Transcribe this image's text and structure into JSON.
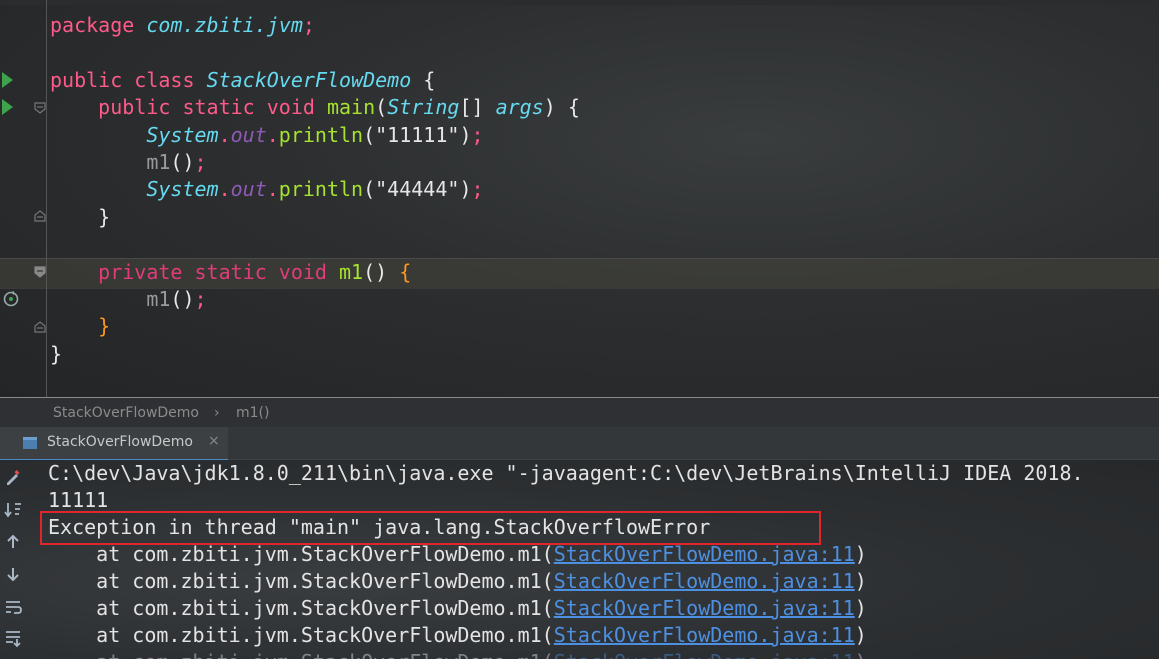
{
  "editor": {
    "lines": [
      {
        "segments": [
          {
            "t": "package ",
            "c": "kw"
          },
          {
            "t": "com.zbiti.jvm",
            "c": "ital-cyan"
          },
          {
            "t": ";",
            "c": "kw"
          }
        ]
      },
      {
        "segments": []
      },
      {
        "segments": [
          {
            "t": "public ",
            "c": "kw"
          },
          {
            "t": "class ",
            "c": "kw"
          },
          {
            "t": "StackOverFlowDemo",
            "c": "ital-cyan"
          },
          {
            "t": " {",
            "c": ""
          }
        ]
      },
      {
        "segments": [
          {
            "t": "    public ",
            "c": "kw"
          },
          {
            "t": "static ",
            "c": "kw"
          },
          {
            "t": "void ",
            "c": "kw"
          },
          {
            "t": "main",
            "c": "green"
          },
          {
            "t": "(",
            "c": ""
          },
          {
            "t": "String",
            "c": "ital-cyan"
          },
          {
            "t": "[] ",
            "c": ""
          },
          {
            "t": "args",
            "c": "ital-cyan"
          },
          {
            "t": ") {",
            "c": ""
          }
        ]
      },
      {
        "segments": [
          {
            "t": "        System",
            "c": "ital-cyan"
          },
          {
            "t": ".",
            "c": "kw"
          },
          {
            "t": "out",
            "c": "ital-purple"
          },
          {
            "t": ".",
            "c": "kw"
          },
          {
            "t": "println",
            "c": "green"
          },
          {
            "t": "(",
            "c": ""
          },
          {
            "t": "\"11111\"",
            "c": "str"
          },
          {
            "t": ")",
            "c": ""
          },
          {
            "t": ";",
            "c": "kw"
          }
        ]
      },
      {
        "segments": [
          {
            "t": "        m1",
            "c": "dimtxt"
          },
          {
            "t": "()",
            "c": ""
          },
          {
            "t": ";",
            "c": "kw"
          }
        ]
      },
      {
        "segments": [
          {
            "t": "        System",
            "c": "ital-cyan"
          },
          {
            "t": ".",
            "c": "kw"
          },
          {
            "t": "out",
            "c": "ital-purple"
          },
          {
            "t": ".",
            "c": "kw"
          },
          {
            "t": "println",
            "c": "green"
          },
          {
            "t": "(",
            "c": ""
          },
          {
            "t": "\"44444\"",
            "c": "str"
          },
          {
            "t": ")",
            "c": ""
          },
          {
            "t": ";",
            "c": "kw"
          }
        ]
      },
      {
        "segments": [
          {
            "t": "    }",
            "c": ""
          }
        ]
      },
      {
        "segments": []
      },
      {
        "segments": [
          {
            "t": "    private ",
            "c": "kw-dim"
          },
          {
            "t": "static ",
            "c": "kw-dim"
          },
          {
            "t": "void ",
            "c": "kw-dim"
          },
          {
            "t": "m1",
            "c": "green"
          },
          {
            "t": "() ",
            "c": ""
          },
          {
            "t": "{",
            "c": "orange"
          }
        ]
      },
      {
        "segments": [
          {
            "t": "        m1",
            "c": "dimtxt"
          },
          {
            "t": "()",
            "c": ""
          },
          {
            "t": ";",
            "c": "kw"
          }
        ]
      },
      {
        "segments": [
          {
            "t": "    }",
            "c": "orange"
          }
        ]
      },
      {
        "segments": [
          {
            "t": "}",
            "c": ""
          }
        ]
      }
    ]
  },
  "breadcrumb": {
    "class_name": "StackOverFlowDemo",
    "method_name": "m1()"
  },
  "run": {
    "tab_label": "StackOverFlowDemo",
    "tab_close": "×",
    "command": "C:\\dev\\Java\\jdk1.8.0_211\\bin\\java.exe \"-javaagent:C:\\dev\\JetBrains\\IntelliJ IDEA 2018.",
    "output1": "11111",
    "exception": "Exception in thread \"main\" java.lang.StackOverflowError",
    "trace_prefix": "    at com.zbiti.jvm.StackOverFlowDemo.m1(",
    "trace_link": "StackOverFlowDemo.java:11",
    "trace_suffix": ")"
  },
  "toolbar_icons": [
    "edit-icon",
    "sort-down-icon",
    "arrow-up-icon",
    "arrow-down-icon",
    "soft-wrap-icon",
    "scroll-to-end-icon"
  ],
  "colors": {
    "error_box": "#e0262c",
    "link": "#4d8fe0",
    "keyword": "#ff5a8a"
  }
}
